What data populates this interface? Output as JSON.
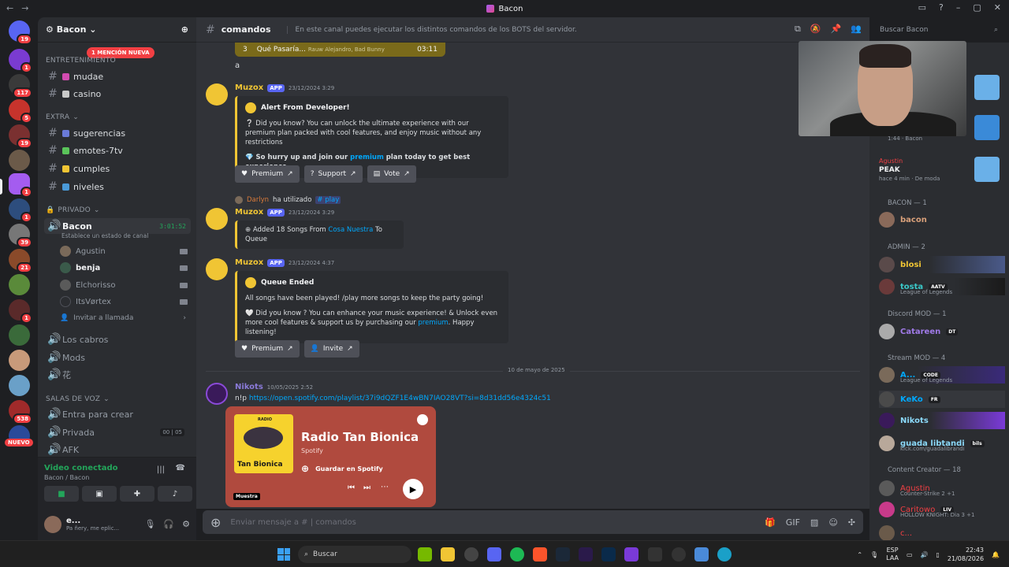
{
  "window": {
    "title": "Bacon"
  },
  "guilds": {
    "badges": [
      "19",
      "1",
      "117",
      "5",
      "19",
      "1",
      "1",
      "39",
      "21",
      "1",
      "538"
    ],
    "nuevo": "NUEVO"
  },
  "server": {
    "name": "Bacon",
    "mention_pill": "1 MENCIÓN NUEVA"
  },
  "categories": {
    "entretenimiento": "ENTRETENIMIENTO",
    "extra": "EXTRA",
    "privado": "PRIVADO",
    "salas": "SALAS DE VOZ"
  },
  "channels": {
    "mudae": "mudae",
    "casino": "casino",
    "sugerencias": "sugerencias",
    "emotes": "emotes-7tv",
    "cumples": "cumples",
    "niveles": "niveles",
    "bacon": "Bacon",
    "bacon_timer": "3:01:52",
    "bacon_status": "Establece un estado de canal",
    "invite": "Invitar a llamada",
    "cabros": "Los cabros",
    "mods": "Mods",
    "flower": "花",
    "crear": "Entra para crear",
    "privada": "Privada",
    "privada_count_a": "00",
    "privada_count_b": "05",
    "afk": "AFK"
  },
  "voice_users": [
    "Agustin",
    "benja",
    "Elchorisso",
    "ItsVørtex"
  ],
  "voice_panel": {
    "title": "Video conectado",
    "sub": "Bacon / Bacon"
  },
  "user_panel": {
    "name": "e...",
    "status": "Pa ñery, me eplic..."
  },
  "header": {
    "channel": "comandos",
    "topic": "En este canal puedes ejecutar los distintos comandos de los BOTS del servidor.",
    "search_placeholder": "Buscar Bacon"
  },
  "chat": {
    "queue_item": {
      "index": "3",
      "title": "Qué Pasaría...",
      "artist": "Rauw Alejandro, Bad Bunny",
      "duration": "03:11"
    },
    "plain_a": "a",
    "m1": {
      "user": "Muzox",
      "tag": "APP",
      "time": "23/12/2024 3:29",
      "embed_title": "Alert From Developer!",
      "p1": "❔ Did you know? You can unlock the ultimate experience with our premium plan packed with cool features, and enjoy music without any restrictions",
      "p2a": "💎 So hurry up and join our ",
      "p2link": "premium",
      "p2b": " plan today to get best experience",
      "btn1": "Premium",
      "btn2": "Support",
      "btn3": "Vote"
    },
    "system": {
      "user": "Darlyn",
      "text": "ha utilizado",
      "cmd": "play"
    },
    "m2": {
      "user": "Muzox",
      "tag": "APP",
      "time": "23/12/2024 3:29",
      "t1": "Added 18 Songs From ",
      "link": "Cosa Nuestra",
      "t2": " To Queue"
    },
    "m3": {
      "user": "Muzox",
      "tag": "APP",
      "time": "23/12/2024 4:37",
      "embed_title": "Queue Ended",
      "p1": "All songs have been played! /play more songs to keep the party going!",
      "p2a": "🤍 Did you know ? You can enhance your music experience! & Unlock even more cool features & support us by purchasing our ",
      "p2link": "premium",
      "p2b": ". Happy listening!",
      "btn1": "Premium",
      "btn2": "Invite"
    },
    "date_divider": "10 de mayo de 2025",
    "m4": {
      "user": "Nikots",
      "time": "10/05/2025 2:52",
      "prefix": "n!p ",
      "url": "https://open.spotify.com/playlist/37i9dQZF1E4wBN7IAO28VT?si=8d31dd56e4324c51"
    },
    "spotify": {
      "cover_label": "RADIO",
      "cover_title": "Tan Bionica",
      "title": "Radio Tan Bionica",
      "sub": "Spotify",
      "save": "Guardar en Spotify",
      "muestra": "Muestra"
    }
  },
  "composer": {
    "placeholder": "Enviar mensaje a #",
    "channel": "comandos"
  },
  "members": {
    "top_time": "1:44",
    "top_label": "Bacon",
    "agustin_top": "Agustin",
    "peak": "PEAK",
    "peak_sub": "hace 4 min",
    "peak_sub2": "De moda",
    "cat_bacon": "BACON — 1",
    "bacon": "bacon",
    "cat_admin": "ADMIN — 2",
    "blosi": "blosi",
    "tosta": "tosta",
    "tosta_tag": "AATV",
    "tosta_act": "League of Legends",
    "cat_discord_mod": "Discord MOD — 1",
    "catareen": "Catareen",
    "catareen_tag": "DT",
    "cat_stream_mod": "Stream MOD — 4",
    "a": "A...",
    "a_tag": "CODE",
    "a_act": "League of Legends",
    "keko": "KeKo",
    "keko_tag": "FR",
    "nikots": "Nikots",
    "guada": "guada libtandi",
    "guada_tag": "bils",
    "guada_act": "kick.com/guadalibrandi",
    "cat_content": "Content Creator — 18",
    "agustin": "Agustin",
    "agustin_act": "Counter-Strike 2 +1",
    "caritowo": "Caritowo",
    "caritowo_tag": "LIV",
    "caritowo_act": "HOLLOW KNIGHT: Dia 3 +1",
    "last": "c..."
  },
  "taskbar": {
    "search": "Buscar",
    "lang": "ESP",
    "lang2": "LAA",
    "time": "22:43",
    "date": "21/08/2026"
  }
}
